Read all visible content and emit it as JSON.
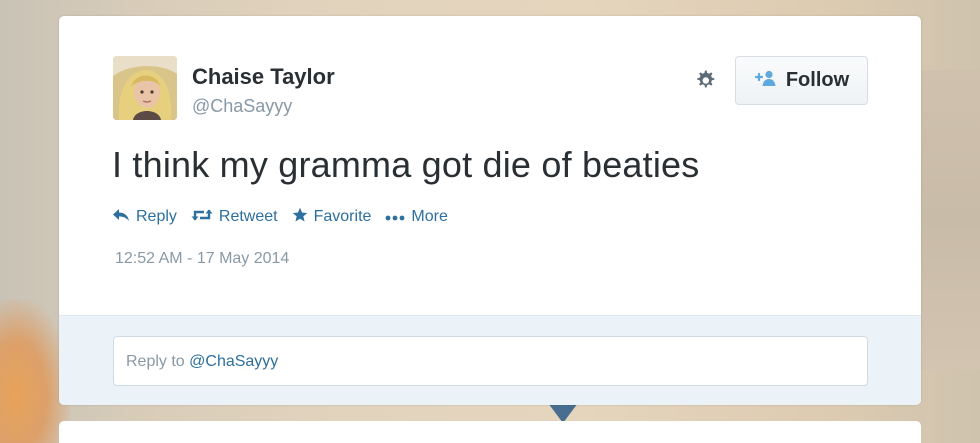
{
  "user": {
    "name": "Chaise Taylor",
    "handle": "@ChaSayyy"
  },
  "header": {
    "follow_label": "Follow"
  },
  "tweet": {
    "text": "I think my gramma got die of beaties",
    "timestamp": "12:52 AM - 17 May 2014"
  },
  "actions": {
    "reply": "Reply",
    "retweet": "Retweet",
    "favorite": "Favorite",
    "more": "More"
  },
  "reply_box": {
    "prefix": "Reply to ",
    "mention": "@ChaSayyy"
  },
  "colors": {
    "link": "#2d6f9e",
    "name": "#292f33",
    "muted": "#8899a6",
    "reply_bg": "#ebf3f8"
  },
  "icons": {
    "settings": "gear-icon",
    "follow": "add-user-icon",
    "reply": "reply-arrow-icon",
    "retweet": "retweet-icon",
    "favorite": "star-icon",
    "more": "ellipsis-icon"
  }
}
